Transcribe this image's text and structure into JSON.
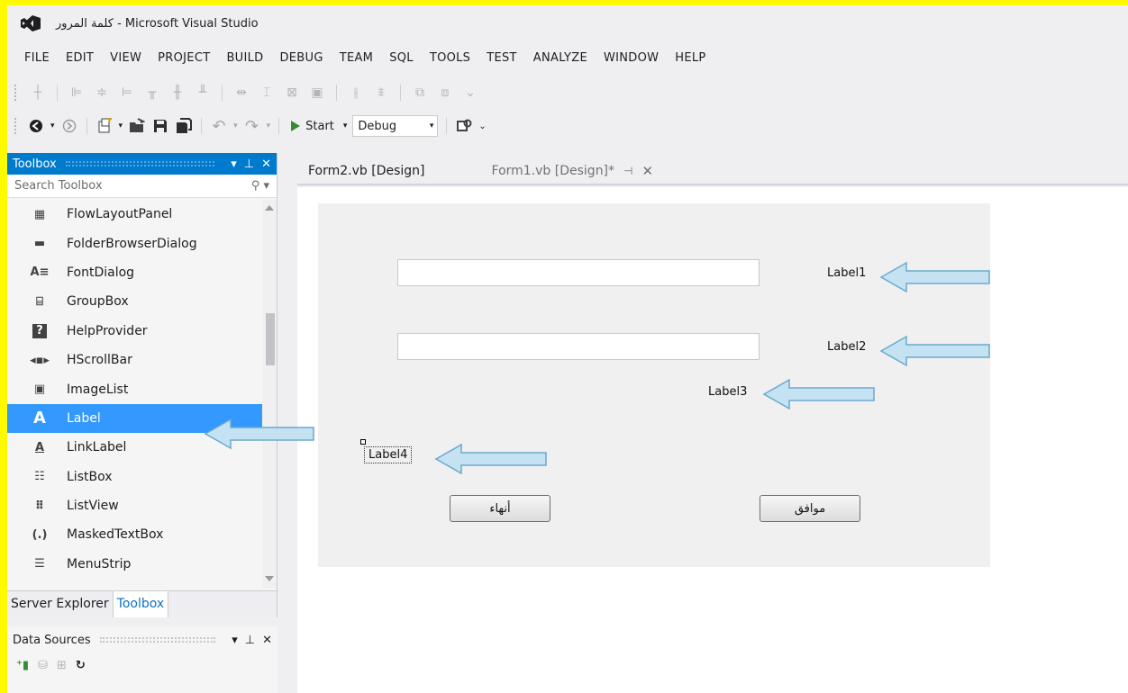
{
  "window": {
    "title": "كلمة المرور - Microsoft Visual Studio"
  },
  "menu": [
    "FILE",
    "EDIT",
    "VIEW",
    "PROJECT",
    "BUILD",
    "DEBUG",
    "TEAM",
    "SQL",
    "TOOLS",
    "TEST",
    "ANALYZE",
    "WINDOW",
    "HELP"
  ],
  "toolbar": {
    "start_label": "Start",
    "config_value": "Debug"
  },
  "toolbox": {
    "title": "Toolbox",
    "search_placeholder": "Search Toolbox",
    "items": [
      {
        "label": "FlowLayoutPanel",
        "icon": "flowlayoutpanel-icon"
      },
      {
        "label": "FolderBrowserDialog",
        "icon": "folderbrowserdialog-icon"
      },
      {
        "label": "FontDialog",
        "icon": "fontdialog-icon"
      },
      {
        "label": "GroupBox",
        "icon": "groupbox-icon"
      },
      {
        "label": "HelpProvider",
        "icon": "helpprovider-icon"
      },
      {
        "label": "HScrollBar",
        "icon": "hscrollbar-icon"
      },
      {
        "label": "ImageList",
        "icon": "imagelist-icon"
      },
      {
        "label": "Label",
        "icon": "label-icon"
      },
      {
        "label": "LinkLabel",
        "icon": "linklabel-icon"
      },
      {
        "label": "ListBox",
        "icon": "listbox-icon"
      },
      {
        "label": "ListView",
        "icon": "listview-icon"
      },
      {
        "label": "MaskedTextBox",
        "icon": "maskedtextbox-icon"
      },
      {
        "label": "MenuStrip",
        "icon": "menustrip-icon"
      }
    ],
    "selected": "Label",
    "tabs": [
      "Server Explorer",
      "Toolbox"
    ]
  },
  "data_sources": {
    "title": "Data Sources"
  },
  "doc_tabs": [
    {
      "label": "Form2.vb [Design]",
      "active": true
    },
    {
      "label": "Form1.vb [Design]*",
      "active": false
    }
  ],
  "form": {
    "labels": {
      "label1": "Label1",
      "label2": "Label2",
      "label3": "Label3",
      "label4": "Label4"
    },
    "buttons": {
      "cancel": "أنهاء",
      "ok": "موافق"
    }
  },
  "colors": {
    "accent": "#007acc",
    "selection": "#3399ff",
    "highlight_border": "#fffa00"
  }
}
